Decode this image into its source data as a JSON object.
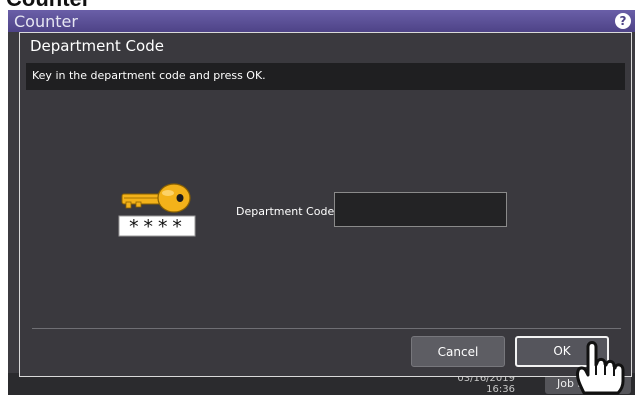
{
  "top_strip": {
    "text": "Counter"
  },
  "screen": {
    "title": "Counter",
    "help_icon": "?",
    "status": {
      "date": "03/16/2019",
      "time": "16:36",
      "job_button": "Job S"
    }
  },
  "dialog": {
    "title": "Department Code",
    "instruction": "Key in the department code and press OK.",
    "key_mask": "****",
    "field_label": "Department Code",
    "field_value": "",
    "cancel_label": "Cancel",
    "ok_label": "OK"
  },
  "colors": {
    "header": "#5b519a",
    "dialog_bg": "#3a393e",
    "instruction_bg": "#1f1f21",
    "key_gold": "#f3b21a"
  },
  "icons": [
    "help-icon",
    "key-icon",
    "hand-pointer-icon"
  ]
}
